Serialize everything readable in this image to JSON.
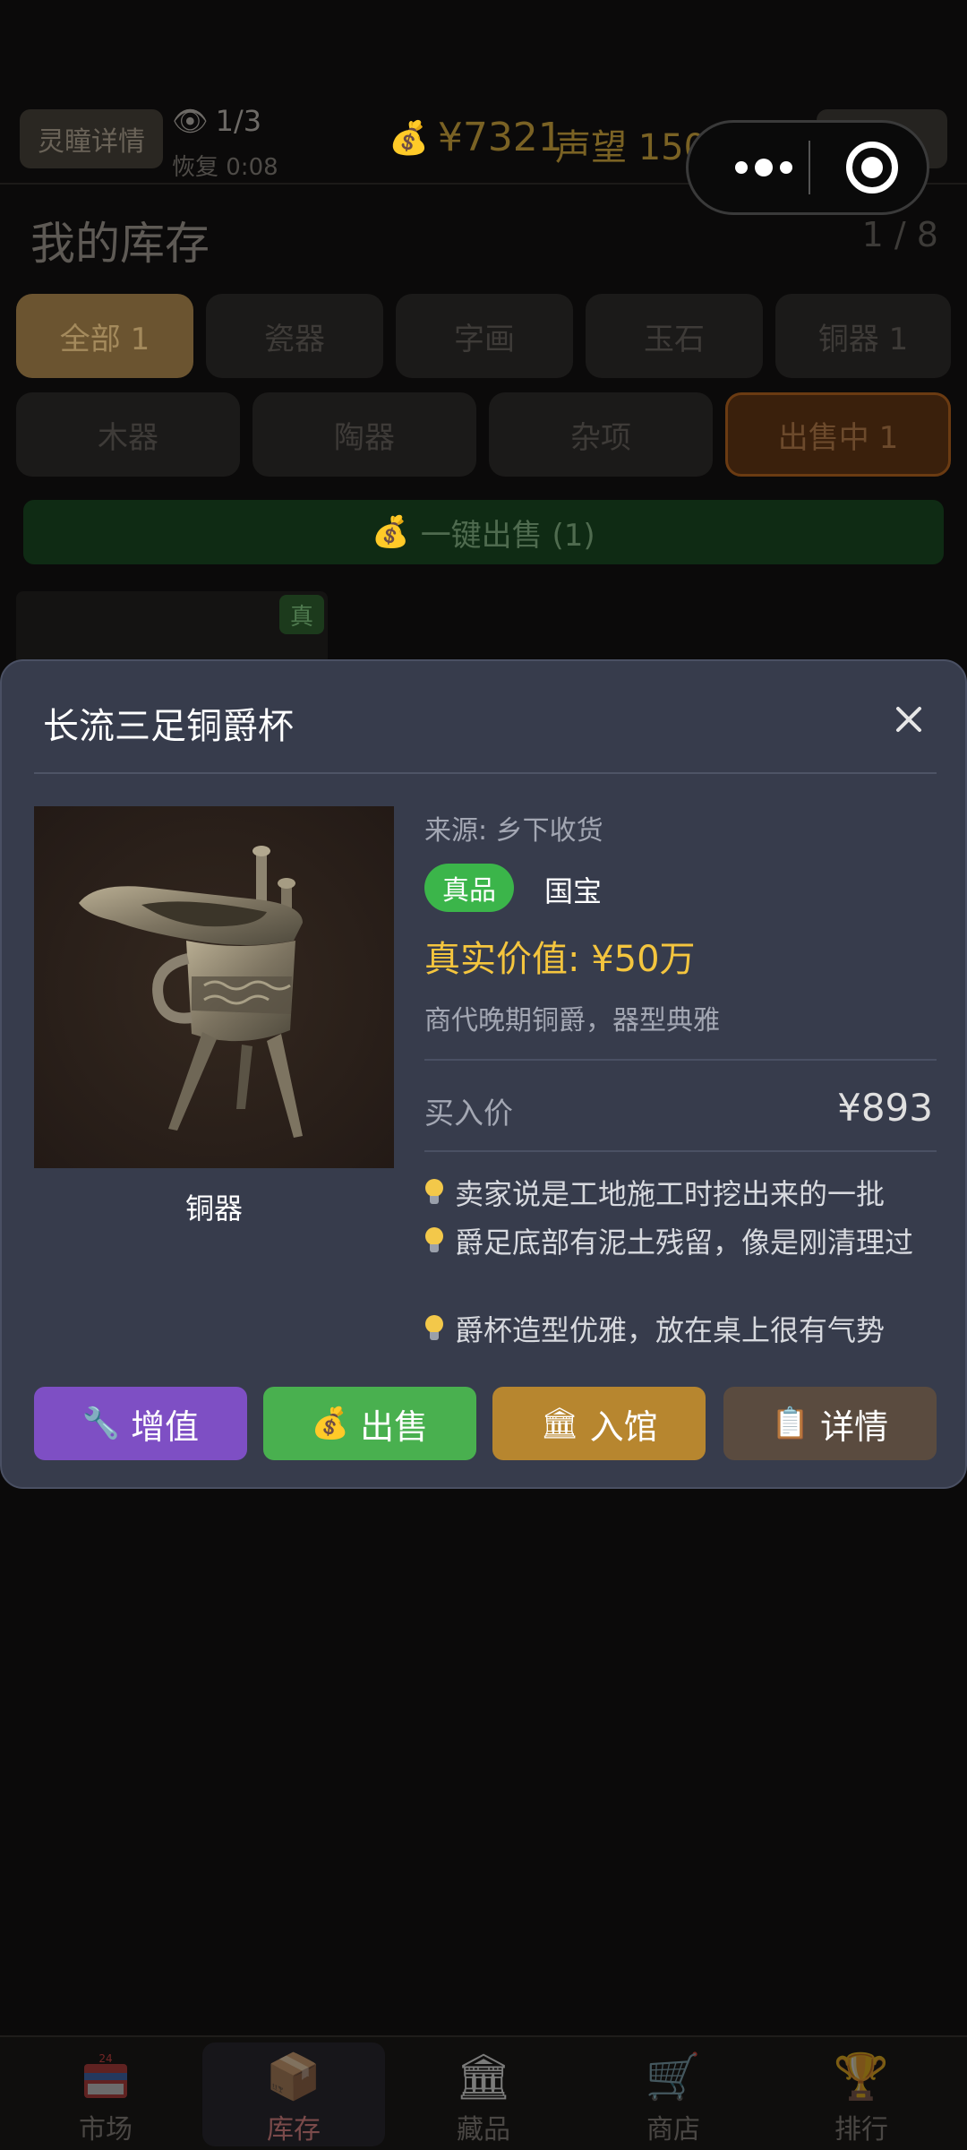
{
  "header": {
    "insight_button": "灵瞳详情",
    "eye_count": "1/3",
    "recover": "恢复 0:08",
    "money": "¥7321",
    "reputation": "声望 1507"
  },
  "inventory": {
    "title": "我的库存",
    "page": "1 / 8",
    "categories_row1": [
      "全部 1",
      "瓷器",
      "字画",
      "玉石",
      "铜器 1"
    ],
    "categories_row2": [
      "木器",
      "陶器",
      "杂项",
      "出售中 1"
    ],
    "sell_all": "一键出售 (1)",
    "card_tag": "真"
  },
  "modal": {
    "title": "长流三足铜爵杯",
    "image_caption": "铜器",
    "source": "来源: 乡下收货",
    "authentic_badge": "真品",
    "grade": "国宝",
    "true_value": "真实价值: ¥50万",
    "description": "商代晚期铜爵，器型典雅",
    "buy_label": "买入价",
    "buy_price": "¥893",
    "hints": [
      "卖家说是工地施工时挖出来的一批",
      "爵足底部有泥土残留，像是刚清理过",
      "爵杯造型优雅，放在桌上很有气势"
    ],
    "buttons": {
      "upgrade": "增值",
      "sell": "出售",
      "museum": "入馆",
      "detail": "详情"
    }
  },
  "tabbar": {
    "market": "市场",
    "inventory": "库存",
    "collection": "藏品",
    "shop": "商店",
    "ranking": "排行",
    "market_badge": "24"
  },
  "colors": {
    "modal_bg": "#373c4c",
    "true_value": "#f4c53e",
    "authentic": "#3bb54a",
    "upgrade": "#7e4fc4",
    "sell": "#49b04f",
    "museum": "#b7862f",
    "detail": "#5a4b3f"
  },
  "icons": {
    "upgrade": "wrench-icon",
    "sell": "money-bag-icon",
    "museum": "museum-icon",
    "detail": "clipboard-icon",
    "close": "close-icon",
    "hint": "lightbulb-icon"
  }
}
